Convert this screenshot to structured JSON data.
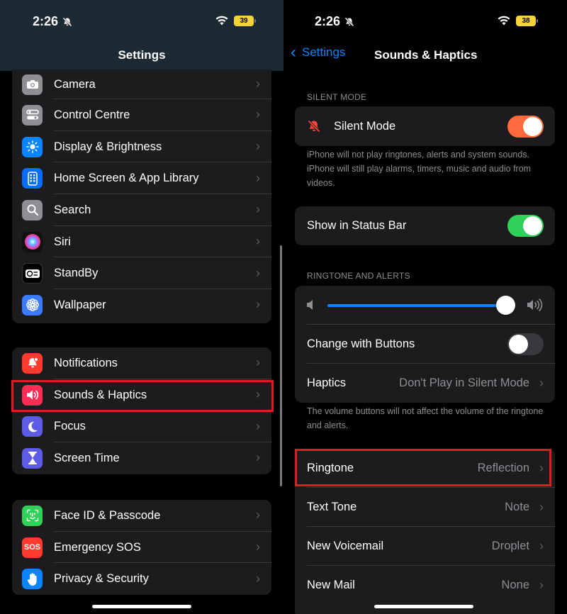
{
  "left": {
    "status": {
      "time": "2:26",
      "battery": "39"
    },
    "nav": {
      "title": "Settings"
    },
    "group1": [
      {
        "label": "Camera",
        "icon": "camera-icon",
        "color": "#8e8e93"
      },
      {
        "label": "Control Centre",
        "icon": "control-centre-icon",
        "color": "#8e8e93"
      },
      {
        "label": "Display & Brightness",
        "icon": "sun-icon",
        "color": "#0a84ff"
      },
      {
        "label": "Home Screen & App Library",
        "icon": "home-screen-icon",
        "color": "#0a6bff"
      },
      {
        "label": "Search",
        "icon": "search-icon",
        "color": "#8e8e93"
      },
      {
        "label": "Siri",
        "icon": "siri-icon",
        "color": "#222"
      },
      {
        "label": "StandBy",
        "icon": "standby-icon",
        "color": "#000"
      },
      {
        "label": "Wallpaper",
        "icon": "wallpaper-icon",
        "color": "#3a7bff"
      }
    ],
    "group2": [
      {
        "label": "Notifications",
        "icon": "bell-icon",
        "color": "#ff3b30"
      },
      {
        "label": "Sounds & Haptics",
        "icon": "speaker-icon",
        "color": "#ff2d55"
      },
      {
        "label": "Focus",
        "icon": "moon-icon",
        "color": "#5e5ce6"
      },
      {
        "label": "Screen Time",
        "icon": "hourglass-icon",
        "color": "#5e5ce6"
      }
    ],
    "group3": [
      {
        "label": "Face ID & Passcode",
        "icon": "face-id-icon",
        "color": "#30d158"
      },
      {
        "label": "Emergency SOS",
        "icon": "sos-icon",
        "color": "#ff3b30",
        "text": "SOS"
      },
      {
        "label": "Privacy & Security",
        "icon": "hand-icon",
        "color": "#0a84ff"
      }
    ]
  },
  "right": {
    "status": {
      "time": "2:26",
      "battery": "38"
    },
    "nav": {
      "back": "Settings",
      "title": "Sounds & Haptics"
    },
    "silent_header": "SILENT MODE",
    "silent_label": "Silent Mode",
    "silent_footer": "iPhone will not play ringtones, alerts and system sounds. iPhone will still play alarms, timers, music and audio from videos.",
    "status_bar_label": "Show in Status Bar",
    "ringtone_header": "RINGTONE AND ALERTS",
    "volume_level": 0.98,
    "change_buttons_label": "Change with Buttons",
    "haptics_label": "Haptics",
    "haptics_value": "Don't Play in Silent Mode",
    "volume_footer": "The volume buttons will not affect the volume of the ringtone and alerts.",
    "tones": [
      {
        "label": "Ringtone",
        "value": "Reflection"
      },
      {
        "label": "Text Tone",
        "value": "Note"
      },
      {
        "label": "New Voicemail",
        "value": "Droplet"
      },
      {
        "label": "New Mail",
        "value": "None"
      }
    ],
    "colors": {
      "toggle_orange": "#ff6b3d",
      "toggle_green": "#30d158",
      "accent": "#0a84ff"
    }
  }
}
